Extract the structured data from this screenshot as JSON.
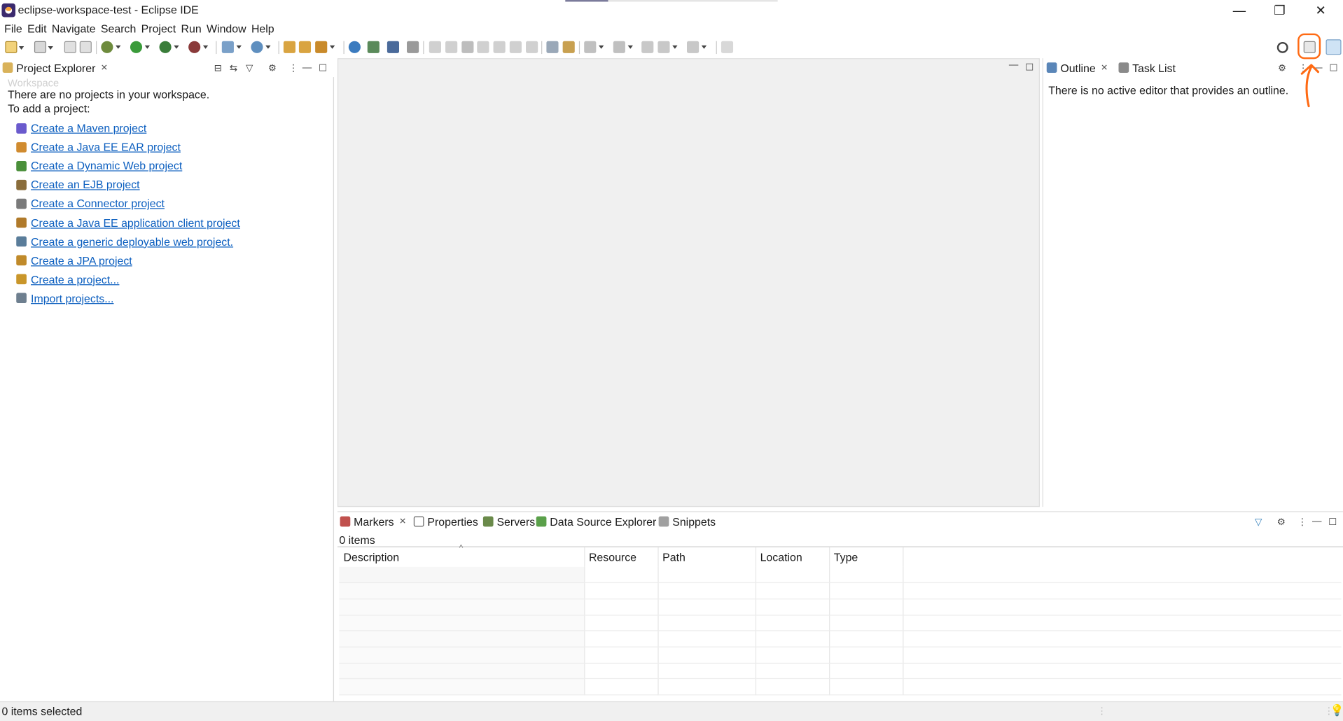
{
  "window": {
    "title": "eclipse-workspace-test - Eclipse IDE",
    "minimize": "—",
    "restore": "❐",
    "close": "✕"
  },
  "menu": [
    "File",
    "Edit",
    "Navigate",
    "Search",
    "Project",
    "Run",
    "Window",
    "Help"
  ],
  "project_explorer": {
    "tab_label": "Project Explorer",
    "hint": "Workspace",
    "message_line1": "There are no projects in your workspace.",
    "message_line2": "To add a project:",
    "links": [
      {
        "label": "Create a Maven project",
        "icon": "maven-project-icon",
        "color": "#6a5acd"
      },
      {
        "label": "Create a Java EE EAR project",
        "icon": "ear-project-icon",
        "color": "#d08b2f"
      },
      {
        "label": "Create a Dynamic Web project",
        "icon": "web-project-icon",
        "color": "#4a8f3a"
      },
      {
        "label": "Create an EJB project",
        "icon": "ejb-project-icon",
        "color": "#8a6d3b"
      },
      {
        "label": "Create a Connector project",
        "icon": "connector-project-icon",
        "color": "#7a7a7a"
      },
      {
        "label": "Create a Java EE application client project",
        "icon": "app-client-icon",
        "color": "#b07a2a"
      },
      {
        "label": "Create a generic deployable web project.",
        "icon": "generic-web-icon",
        "color": "#5a7d9a"
      },
      {
        "label": "Create a JPA project",
        "icon": "jpa-project-icon",
        "color": "#c08a2a"
      },
      {
        "label": "Create a project...",
        "icon": "new-project-icon",
        "color": "#c9962a"
      },
      {
        "label": "Import projects...",
        "icon": "import-icon",
        "color": "#6e7f8f"
      }
    ]
  },
  "outline": {
    "tabs": [
      {
        "label": "Outline"
      },
      {
        "label": "Task List"
      }
    ],
    "message": "There is no active editor that provides an outline."
  },
  "bottom": {
    "tabs": [
      {
        "label": "Markers",
        "icon": "markers-icon"
      },
      {
        "label": "Properties",
        "icon": "properties-icon"
      },
      {
        "label": "Servers",
        "icon": "servers-icon"
      },
      {
        "label": "Data Source Explorer",
        "icon": "datasource-icon"
      },
      {
        "label": "Snippets",
        "icon": "snippets-icon"
      }
    ],
    "count": "0 items",
    "columns": [
      "Description",
      "Resource",
      "Path",
      "Location",
      "Type"
    ]
  },
  "status": {
    "text": "0 items selected"
  },
  "colors": {
    "link": "#0b5ebf",
    "annotation": "#ff6a13",
    "editor_bg": "#f0f0f0"
  }
}
